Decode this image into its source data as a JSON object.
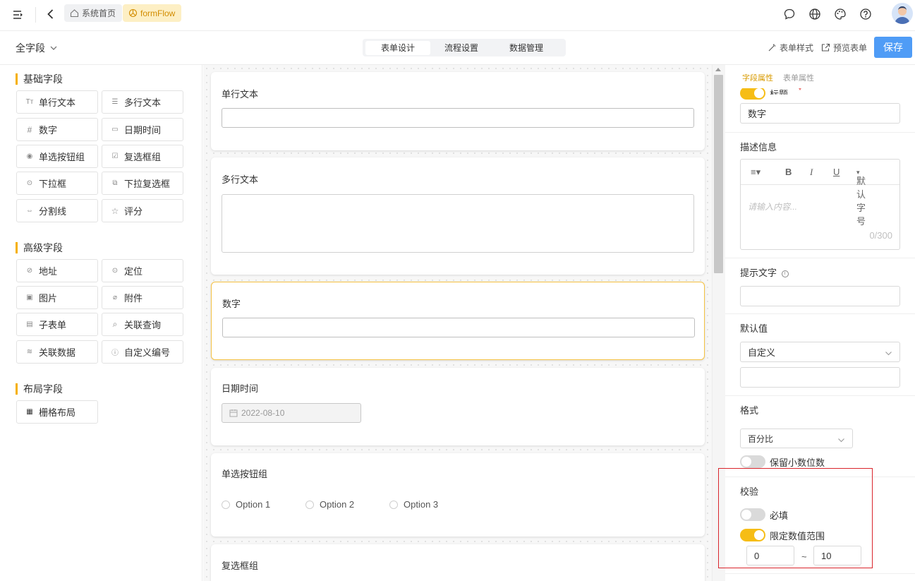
{
  "header": {
    "breadcrumbs": [
      {
        "label": "系统首页",
        "icon": "home-icon"
      },
      {
        "label": "formFlow",
        "icon": "flow-icon"
      }
    ],
    "right_icons": [
      "chat-icon",
      "globe-icon",
      "palette-icon",
      "help-icon",
      "avatar"
    ]
  },
  "toolbar": {
    "field_filter": "全字段",
    "tabs": [
      "表单设计",
      "流程设置",
      "数据管理"
    ],
    "active_tab": "表单设计",
    "style_label": "表单样式",
    "preview_label": "预览表单",
    "save_label": "保存"
  },
  "palette": {
    "basic": {
      "title": "基础字段",
      "items": [
        "单行文本",
        "多行文本",
        "数字",
        "日期时间",
        "单选按钮组",
        "复选框组",
        "下拉框",
        "下拉复选框",
        "分割线",
        "评分"
      ]
    },
    "advanced": {
      "title": "高级字段",
      "items": [
        "地址",
        "定位",
        "图片",
        "附件",
        "子表单",
        "关联查询",
        "关联数据",
        "自定义编号"
      ]
    },
    "layout": {
      "title": "布局字段",
      "items": [
        "栅格布局"
      ]
    }
  },
  "canvas": {
    "cards": [
      {
        "label": "单行文本"
      },
      {
        "label": "多行文本"
      },
      {
        "label": "数字",
        "selected": true
      },
      {
        "label": "日期时间",
        "value": "2022-08-10"
      },
      {
        "label": "单选按钮组",
        "options": [
          "Option 1",
          "Option 2",
          "Option 3"
        ]
      },
      {
        "label": "复选框组"
      }
    ]
  },
  "props": {
    "tabs": [
      "字段属性",
      "表单属性"
    ],
    "active_tab": "字段属性",
    "title_label": "标题",
    "title_value": "数字",
    "desc_label": "描述信息",
    "editor": {
      "font_size": "默认字号",
      "placeholder": "请输入内容...",
      "count": "0/300"
    },
    "hint_label": "提示文字",
    "default_label": "默认值",
    "default_mode": "自定义",
    "format_label": "格式",
    "format_value": "百分比",
    "decimal_label": "保留小数位数",
    "validation": {
      "title": "校验",
      "required_label": "必填",
      "required_on": false,
      "range_label": "限定数值范围",
      "range_on": true,
      "min": "0",
      "sep": "~",
      "max": "10"
    }
  },
  "colors": {
    "accent": "#f6bd16",
    "primary_button": "#4f9cf6",
    "highlight_box": "#d9252c"
  }
}
